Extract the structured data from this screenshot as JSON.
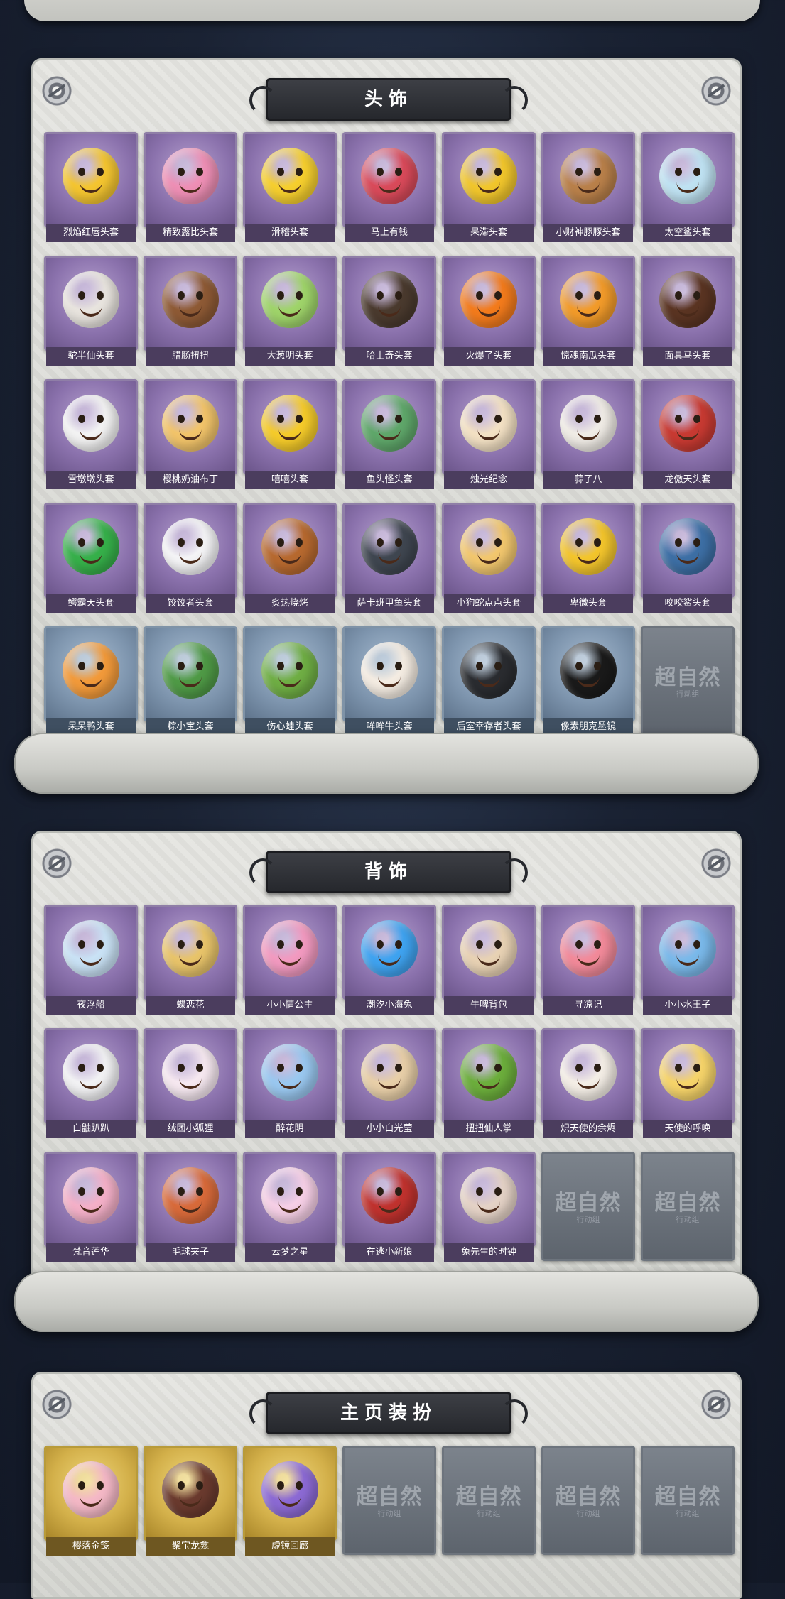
{
  "sections": [
    {
      "title": "头饰",
      "items": [
        {
          "label": "烈焰红唇头套",
          "color": "#f4c530"
        },
        {
          "label": "精致露比头套",
          "color": "#ee8fb5"
        },
        {
          "label": "滑稽头套",
          "color": "#f6cf2e"
        },
        {
          "label": "马上有钱",
          "color": "#d94a5a"
        },
        {
          "label": "呆滞头套",
          "color": "#f1c62c"
        },
        {
          "label": "小财神豚豚头套",
          "color": "#b9804a"
        },
        {
          "label": "太空鲨头套",
          "color": "#bfe2f2"
        },
        {
          "label": "驼半仙头套",
          "color": "#e8e4de"
        },
        {
          "label": "腊肠扭扭",
          "color": "#8e5a35"
        },
        {
          "label": "大葱明头套",
          "color": "#9fd46a"
        },
        {
          "label": "哈士奇头套",
          "color": "#4a3a2e"
        },
        {
          "label": "火爆了头套",
          "color": "#f37b1c"
        },
        {
          "label": "惊魂南瓜头套",
          "color": "#f29b2a"
        },
        {
          "label": "面具马头套",
          "color": "#5a3422"
        },
        {
          "label": "雪墩墩头套",
          "color": "#f3f3f3"
        },
        {
          "label": "樱桃奶油布丁",
          "color": "#f2c46a"
        },
        {
          "label": "嘻嘻头套",
          "color": "#f5cb2a"
        },
        {
          "label": "鱼头怪头套",
          "color": "#5fa76a"
        },
        {
          "label": "烛光纪念",
          "color": "#f3e1c4"
        },
        {
          "label": "蒜了八",
          "color": "#f0ece6"
        },
        {
          "label": "龙傲天头套",
          "color": "#c83a32"
        },
        {
          "label": "鳄霸天头套",
          "color": "#36b04a"
        },
        {
          "label": "饺饺者头套",
          "color": "#f4f4f6"
        },
        {
          "label": "炙热烧烤",
          "color": "#b7692f"
        },
        {
          "label": "萨卡班甲鱼头套",
          "color": "#3f4650"
        },
        {
          "label": "小狗蛇点点头套",
          "color": "#f2c76e"
        },
        {
          "label": "卑微头套",
          "color": "#f3c52c"
        },
        {
          "label": "咬咬鲨头套",
          "color": "#3d6fa5"
        },
        {
          "label": "呆呆鸭头套",
          "color": "#f29a3a",
          "style": "blue"
        },
        {
          "label": "粽小宝头套",
          "color": "#4f9a46",
          "style": "blue"
        },
        {
          "label": "伤心蛙头套",
          "color": "#6fae44",
          "style": "blue"
        },
        {
          "label": "哞哞牛头套",
          "color": "#f4ece2",
          "style": "blue"
        },
        {
          "label": "后室幸存者头套",
          "color": "#2a2c30",
          "style": "blue"
        },
        {
          "label": "像素朋克墨镜",
          "color": "#1a1a1a",
          "style": "blue"
        },
        {
          "label": "",
          "style": "empty"
        }
      ]
    },
    {
      "title": "背饰",
      "items": [
        {
          "label": "夜浮船",
          "color": "#c9e2f5"
        },
        {
          "label": "蝶恋花",
          "color": "#e8c46a"
        },
        {
          "label": "小小情公主",
          "color": "#f29ac0"
        },
        {
          "label": "潮汐小海兔",
          "color": "#3fa3f0"
        },
        {
          "label": "牛啤背包",
          "color": "#e8d2b4"
        },
        {
          "label": "寻凉记",
          "color": "#f28a9a"
        },
        {
          "label": "小小水王子",
          "color": "#7ab9ea"
        },
        {
          "label": "白鼬趴趴",
          "color": "#f2f2f4"
        },
        {
          "label": "绒团小狐狸",
          "color": "#f6e8f0"
        },
        {
          "label": "醉花阴",
          "color": "#9ac8f0"
        },
        {
          "label": "小小白光莹",
          "color": "#e8cfa8"
        },
        {
          "label": "扭扭仙人掌",
          "color": "#6cae3c"
        },
        {
          "label": "炽天使的余烬",
          "color": "#f4eee6"
        },
        {
          "label": "天使的呼唤",
          "color": "#f6d46a"
        },
        {
          "label": "梵音莲华",
          "color": "#f4b0c8"
        },
        {
          "label": "毛球夹子",
          "color": "#d86a3a"
        },
        {
          "label": "云梦之星",
          "color": "#f6cfe6"
        },
        {
          "label": "在逃小新娘",
          "color": "#c0322e"
        },
        {
          "label": "兔先生的时钟",
          "color": "#e4d2c6"
        },
        {
          "label": "",
          "style": "empty"
        },
        {
          "label": "",
          "style": "empty"
        }
      ]
    },
    {
      "title": "主页装扮",
      "items": [
        {
          "label": "樱落金笺",
          "color": "#f4b8c6",
          "style": "gold"
        },
        {
          "label": "聚宝龙龛",
          "color": "#6a3a2e",
          "style": "gold"
        },
        {
          "label": "虚镜回廊",
          "color": "#8c6ad4",
          "style": "gold"
        },
        {
          "label": "",
          "style": "empty"
        },
        {
          "label": "",
          "style": "empty"
        },
        {
          "label": "",
          "style": "empty"
        },
        {
          "label": "",
          "style": "empty"
        }
      ]
    }
  ],
  "placeholder": {
    "logo": "超自然",
    "sub": "行动组"
  }
}
